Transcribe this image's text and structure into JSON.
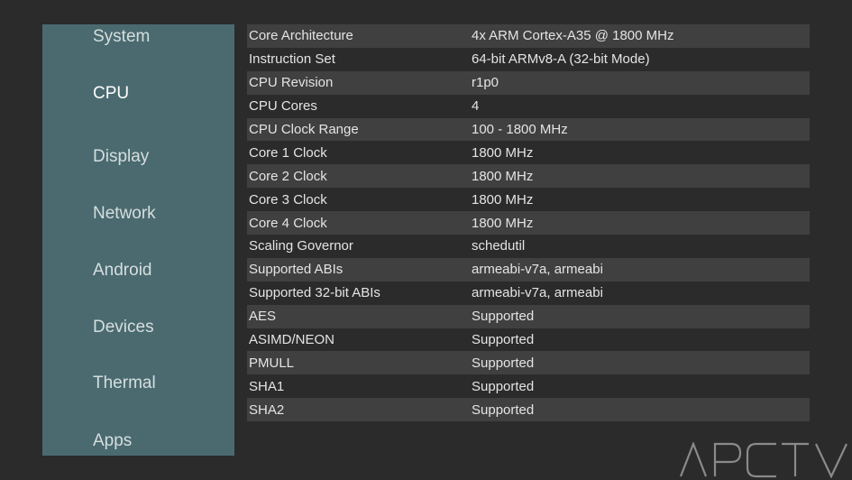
{
  "sidebar": {
    "items": [
      {
        "label": "System",
        "selected": false
      },
      {
        "label": "CPU",
        "selected": true
      },
      {
        "label": "Display",
        "selected": false
      },
      {
        "label": "Network",
        "selected": false
      },
      {
        "label": "Android",
        "selected": false
      },
      {
        "label": "Devices",
        "selected": false
      },
      {
        "label": "Thermal",
        "selected": false
      },
      {
        "label": "Apps",
        "selected": false
      }
    ]
  },
  "cpu_info": {
    "rows": [
      {
        "key": "Core Architecture",
        "value": "4x ARM Cortex-A35 @ 1800 MHz"
      },
      {
        "key": "Instruction Set",
        "value": "64-bit ARMv8-A (32-bit Mode)"
      },
      {
        "key": "CPU Revision",
        "value": "r1p0"
      },
      {
        "key": "CPU Cores",
        "value": "4"
      },
      {
        "key": "CPU Clock Range",
        "value": "100 - 1800 MHz"
      },
      {
        "key": "Core 1 Clock",
        "value": "1800 MHz"
      },
      {
        "key": "Core 2 Clock",
        "value": "1800 MHz"
      },
      {
        "key": "Core 3 Clock",
        "value": "1800 MHz"
      },
      {
        "key": "Core 4 Clock",
        "value": "1800 MHz"
      },
      {
        "key": "Scaling Governor",
        "value": "schedutil"
      },
      {
        "key": "Supported ABIs",
        "value": "armeabi-v7a, armeabi"
      },
      {
        "key": "Supported 32-bit ABIs",
        "value": "armeabi-v7a, armeabi"
      },
      {
        "key": "AES",
        "value": "Supported"
      },
      {
        "key": "ASIMD/NEON",
        "value": "Supported"
      },
      {
        "key": "PMULL",
        "value": "Supported"
      },
      {
        "key": "SHA1",
        "value": "Supported"
      },
      {
        "key": "SHA2",
        "value": "Supported"
      }
    ]
  },
  "watermark": {
    "text": "APCTV"
  },
  "colors": {
    "background": "#2b2b2b",
    "sidebar": "#4a6a70",
    "row_alt": "#404040",
    "text": "#e4e4e4"
  }
}
